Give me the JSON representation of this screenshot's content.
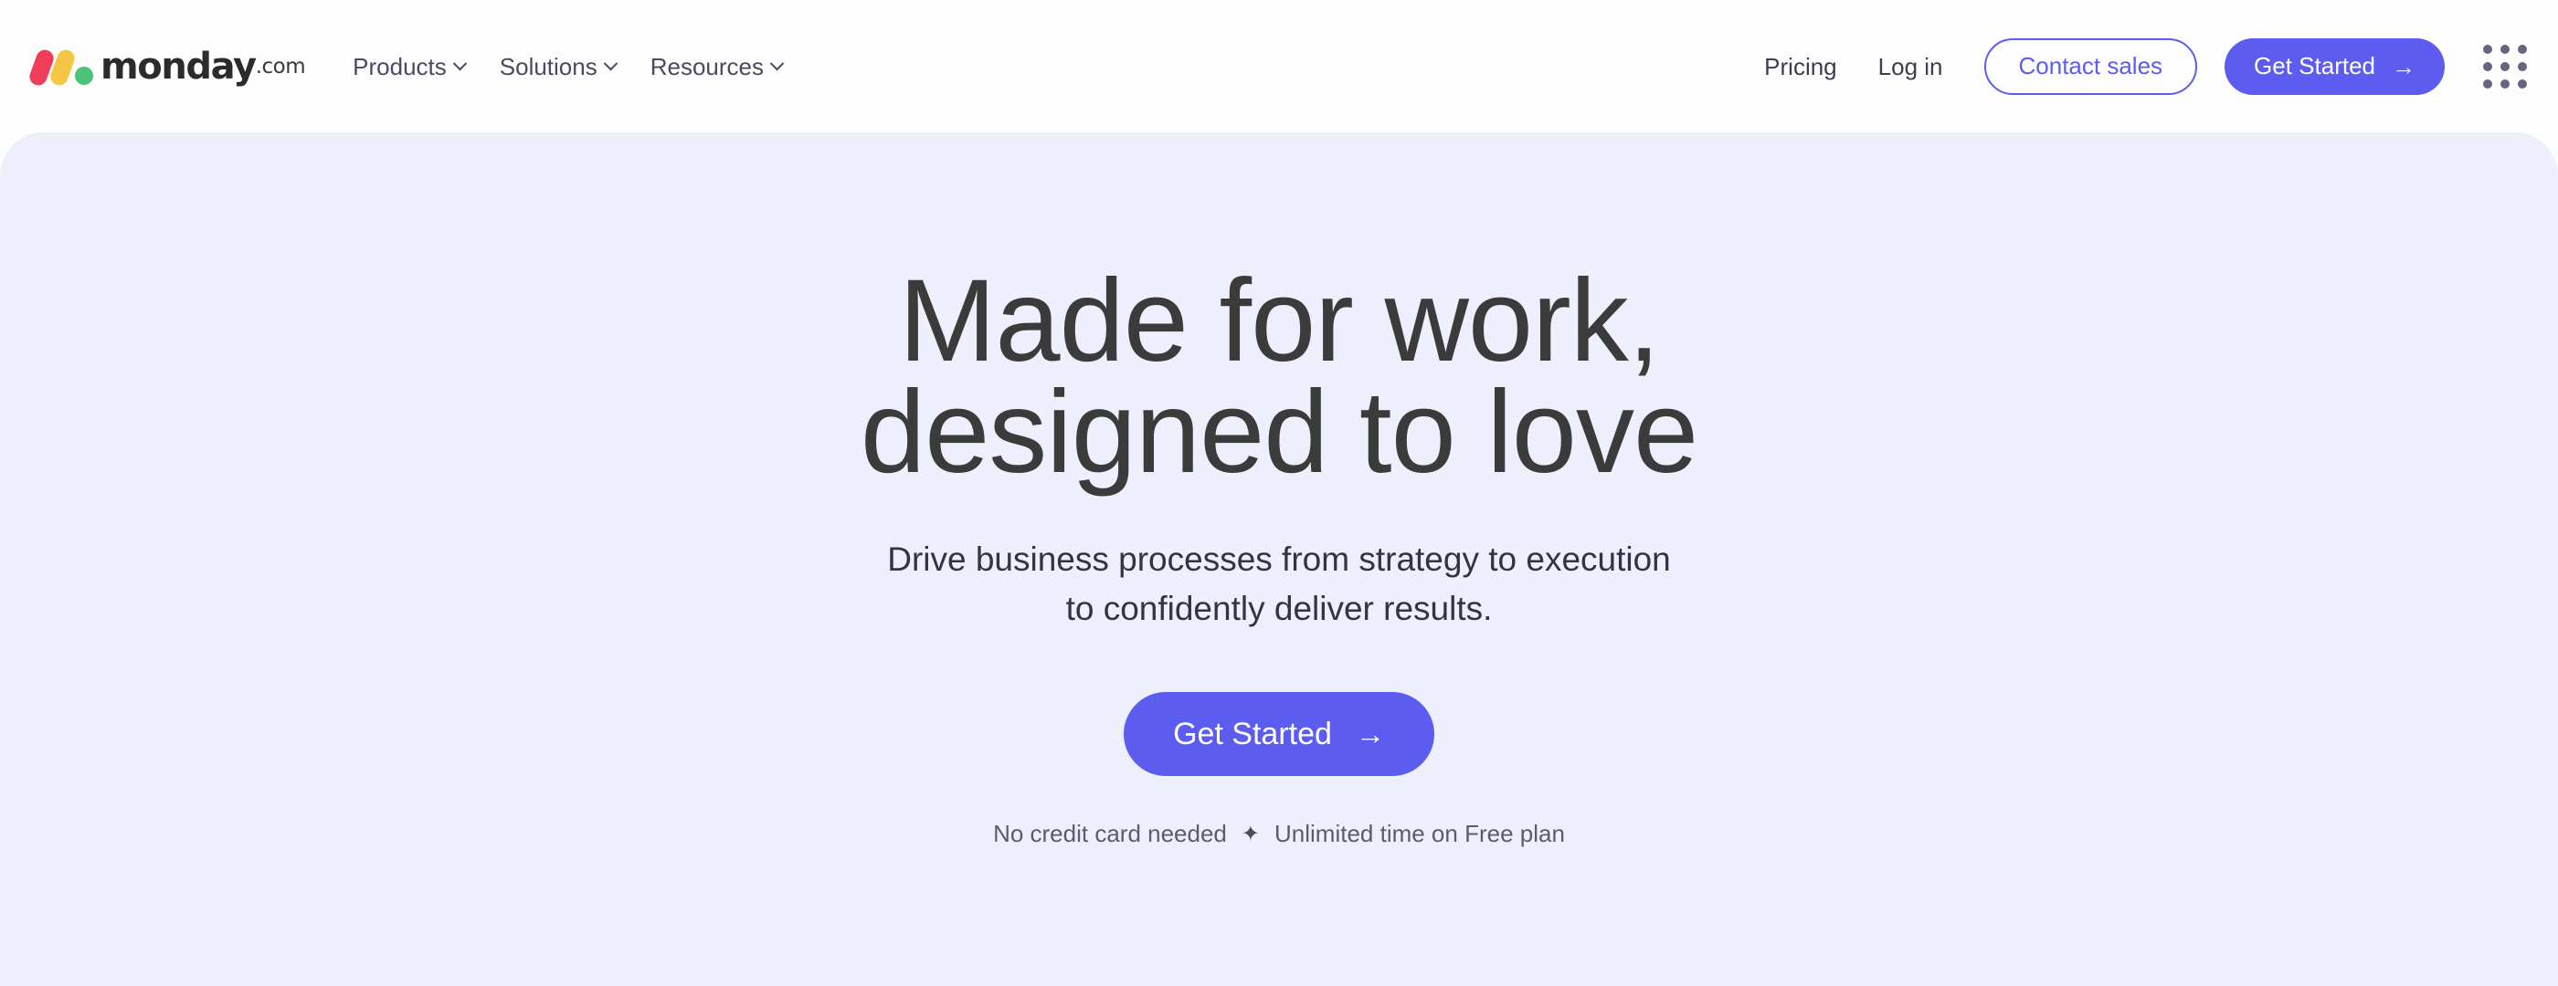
{
  "brand": {
    "name": "monday",
    "suffix": ".com",
    "colors": {
      "accent": "#5c5cf0",
      "logo_red": "#ef3c5a",
      "logo_yellow": "#f5c544",
      "logo_green": "#4bc477",
      "hero_background": "#edeffc",
      "header_background": "#fdfdfd",
      "heading_text": "#3b3b3b"
    }
  },
  "header": {
    "nav_left": [
      {
        "label": "Products",
        "icon": "chevron-down-icon"
      },
      {
        "label": "Solutions",
        "icon": "chevron-down-icon"
      },
      {
        "label": "Resources",
        "icon": "chevron-down-icon"
      }
    ],
    "nav_right": {
      "pricing_label": "Pricing",
      "login_label": "Log in",
      "contact_sales_label": "Contact sales",
      "get_started_label": "Get Started",
      "get_started_arrow": "→",
      "apps_grid_icon": "grid-dots-icon"
    }
  },
  "hero": {
    "title_line_1": "Made for work,",
    "title_line_2": "designed to love",
    "subtitle_line_1": "Drive business processes from strategy to execution",
    "subtitle_line_2": "to confidently deliver results.",
    "cta_label": "Get Started",
    "cta_arrow": "→",
    "note_left": "No credit card needed",
    "note_separator": "✦",
    "note_right": "Unlimited time on Free plan"
  }
}
